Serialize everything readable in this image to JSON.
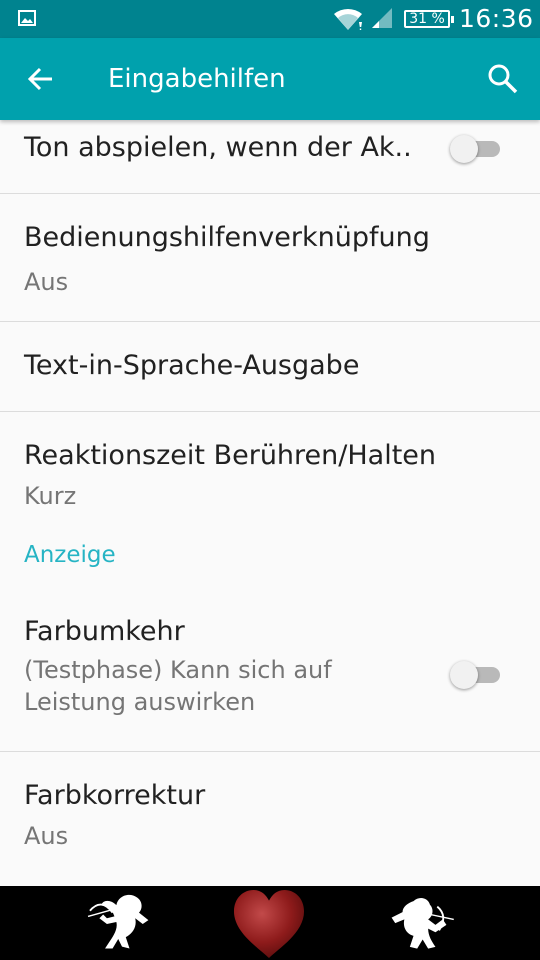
{
  "status_bar": {
    "battery": "31 %",
    "time": "16:36",
    "icons": [
      "gallery-icon",
      "wifi-icon",
      "signal-icon",
      "battery-icon"
    ]
  },
  "app_bar": {
    "title": "Eingabehilfen",
    "icons": [
      "back-arrow-icon",
      "search-icon"
    ]
  },
  "items": [
    {
      "title": "Ton abspielen, wenn der Ak..",
      "toggle": "off"
    },
    {
      "title": "Bedienungshilfenverknüpfung",
      "subtitle": "Aus"
    },
    {
      "title": "Text-in-Sprache-Ausgabe"
    },
    {
      "title": "Reaktionszeit Berühren/Halten",
      "subtitle": "Kurz"
    }
  ],
  "section": {
    "title": "Anzeige"
  },
  "display_items": [
    {
      "title": "Farbumkehr",
      "subtitle": "(Testphase) Kann sich auf Leistung auswirken",
      "toggle": "off"
    },
    {
      "title": "Farbkorrektur",
      "subtitle": "Aus"
    }
  ],
  "decoration": {
    "icons": [
      "cupid-left-icon",
      "heart-icon",
      "cupid-right-icon"
    ],
    "heart_color": "#8e1b1b"
  },
  "colors": {
    "status_bar": "#00838f",
    "app_bar": "#00a1ad",
    "accent": "#26b4c4"
  }
}
